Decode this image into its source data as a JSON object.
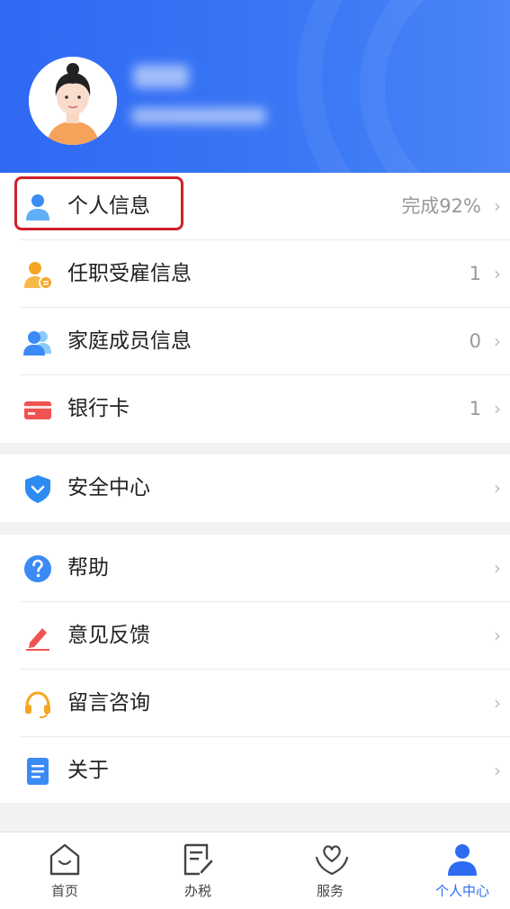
{
  "profile": {
    "name_masked": "",
    "id_masked": ""
  },
  "menu_group1": [
    {
      "label": "个人信息",
      "value": "完成92%",
      "icon": "person-icon"
    },
    {
      "label": "任职受雇信息",
      "value": "1",
      "icon": "employment-icon"
    },
    {
      "label": "家庭成员信息",
      "value": "0",
      "icon": "family-icon"
    },
    {
      "label": "银行卡",
      "value": "1",
      "icon": "bank-card-icon"
    }
  ],
  "menu_group2": [
    {
      "label": "安全中心",
      "icon": "shield-icon"
    }
  ],
  "menu_group3": [
    {
      "label": "帮助",
      "icon": "help-icon"
    },
    {
      "label": "意见反馈",
      "icon": "feedback-pen-icon"
    },
    {
      "label": "留言咨询",
      "icon": "headset-icon"
    },
    {
      "label": "关于",
      "icon": "document-icon"
    }
  ],
  "tabbar": [
    {
      "label": "首页",
      "icon": "home-icon"
    },
    {
      "label": "办税",
      "icon": "tax-form-icon"
    },
    {
      "label": "服务",
      "icon": "heart-hands-icon"
    },
    {
      "label": "个人中心",
      "icon": "person-center-icon",
      "active": true
    }
  ],
  "colors": {
    "primary": "#2f69f3",
    "highlight": "#d0202a",
    "active_tab": "#2d6cf0"
  }
}
